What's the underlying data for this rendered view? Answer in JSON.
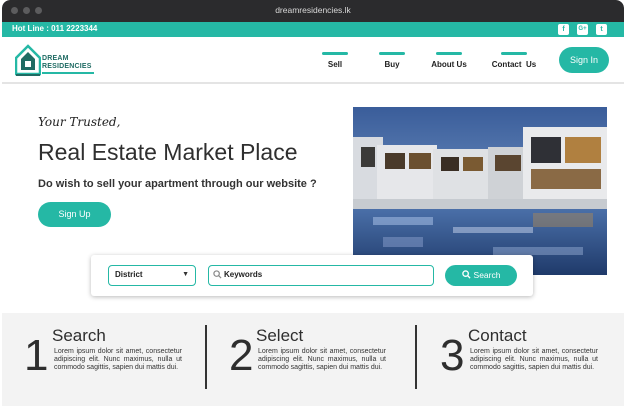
{
  "browser": {
    "url": "dreamresidencies.lk"
  },
  "topbar": {
    "hotline": "Hot Line : 011 2223344",
    "social": [
      {
        "name": "facebook-icon",
        "glyph": "f"
      },
      {
        "name": "google-plus-icon",
        "glyph": "G+"
      },
      {
        "name": "twitter-icon",
        "glyph": "t"
      }
    ]
  },
  "brand": {
    "line1": "DREAM",
    "line2": "RESIDENCIES"
  },
  "nav": {
    "items": [
      "Sell",
      "Buy",
      "About Us",
      "Contact  Us"
    ],
    "signin_label": "Sign In"
  },
  "hero": {
    "tagline": "Your Trusted,",
    "title": "Real Estate Market Place",
    "subtitle": "Do wish to sell your apartment through our website ?",
    "signup_label": "Sign Up"
  },
  "search": {
    "district_value": "District",
    "keywords_placeholder": "Keywords",
    "button_label": "Search"
  },
  "steps": [
    {
      "number": "1",
      "title": "Search",
      "desc": "Lorem ipsum dolor sit amet, consectetur adipiscing elit. Nunc maximus, nulla ut commodo sagittis, sapien dui mattis dui."
    },
    {
      "number": "2",
      "title": "Select",
      "desc": "Lorem ipsum dolor sit amet, consectetur adipiscing elit. Nunc maximus, nulla ut commodo sagittis, sapien dui mattis dui."
    },
    {
      "number": "3",
      "title": "Contact",
      "desc": "Lorem ipsum dolor sit amet, consectetur adipiscing elit. Nunc maximus, nulla ut commodo sagittis, sapien dui mattis dui."
    }
  ],
  "colors": {
    "accent": "#25b8a5",
    "titlebar": "#2b2b2d",
    "text": "#2e2e2e"
  }
}
